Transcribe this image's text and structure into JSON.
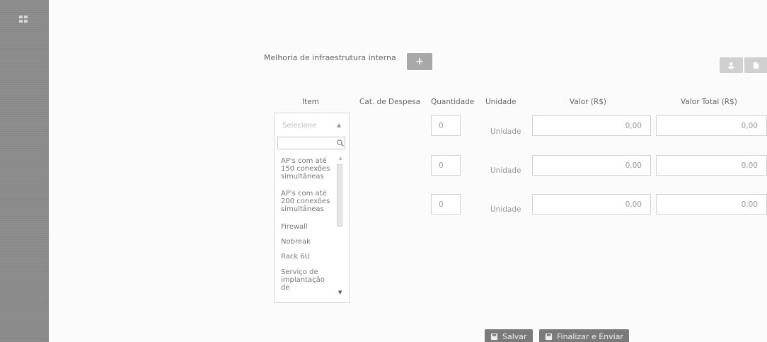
{
  "page": {
    "project_title": "Melhoria de infraestrutura interna",
    "add_button_symbol": "+"
  },
  "table": {
    "headers": [
      "Item",
      "Cat. de Despesa",
      "Quantidade",
      "Unidade",
      "Valor (R$)",
      "Valor Total (R$)"
    ],
    "rows": [
      {
        "quantidade": "0",
        "unidade": "Unidade",
        "valor": "0,00",
        "valor_total": "0,00"
      },
      {
        "quantidade": "0",
        "unidade": "Unidade",
        "valor": "0,00",
        "valor_total": "0,00"
      },
      {
        "quantidade": "0",
        "unidade": "Unidade",
        "valor": "0,00",
        "valor_total": "0,00"
      }
    ]
  },
  "dropdown": {
    "selected": "Selecione",
    "search_placeholder": "",
    "options": [
      [
        "AP's com até",
        "150 conexões",
        "simultâneas"
      ],
      [
        "AP's com até",
        "200 conexões",
        "simultâneas"
      ],
      [
        "Firewall"
      ],
      [
        "Nobreak"
      ],
      [
        "Rack 6U"
      ],
      [
        "Serviço de",
        "implantação",
        "de"
      ]
    ]
  },
  "actions": {
    "save_label": "Salvar",
    "finalize_label": "Finalizar e Enviar"
  },
  "icons": {
    "sidebar_menu": "grid-icon",
    "add": "plus-icon",
    "top_right_1": "user-icon",
    "top_right_2": "document-icon",
    "search": "search-icon",
    "save": "floppy-icon",
    "finalize": "send-icon"
  }
}
